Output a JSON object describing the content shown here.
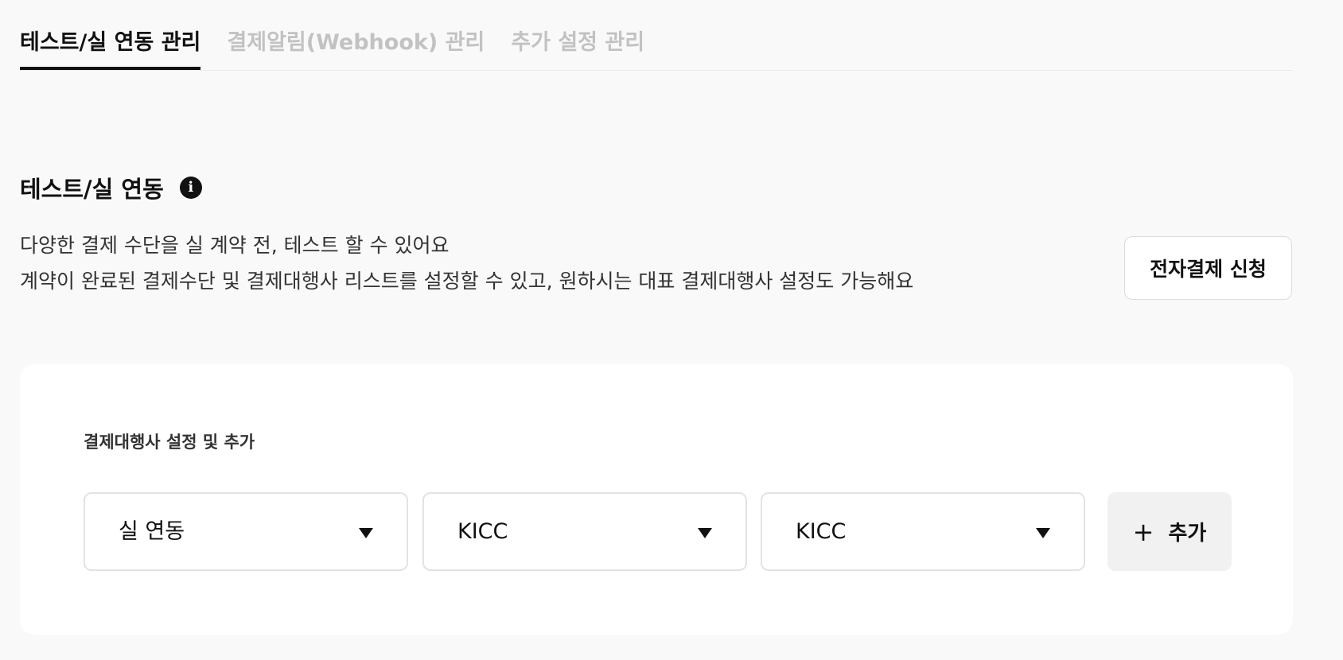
{
  "tabs": [
    {
      "label": "테스트/실 연동 관리",
      "active": true
    },
    {
      "label": "결제알림(Webhook) 관리",
      "active": false
    },
    {
      "label": "추가 설정 관리",
      "active": false
    }
  ],
  "section": {
    "title": "테스트/실 연동",
    "info_icon": "info-icon",
    "description_line1": "다양한 결제 수단을 실 계약 전, 테스트 할 수 있어요",
    "description_line2": "계약이 완료된 결제수단 및 결제대행사 리스트를 설정할 수 있고, 원하시는 대표 결제대행사 설정도 가능해요",
    "apply_button": "전자결제 신청"
  },
  "pg_settings": {
    "label": "결제대행사 설정 및 추가",
    "selects": [
      {
        "value": "실 연동"
      },
      {
        "value": "KICC"
      },
      {
        "value": "KICC"
      }
    ],
    "add_button_icon": "+",
    "add_button": "추가"
  },
  "colors": {
    "background": "#f9f9f9",
    "text": "#111111",
    "inactive_tab": "#c2c2c2",
    "card": "#ffffff",
    "add_button_bg": "#f1f1f1"
  }
}
